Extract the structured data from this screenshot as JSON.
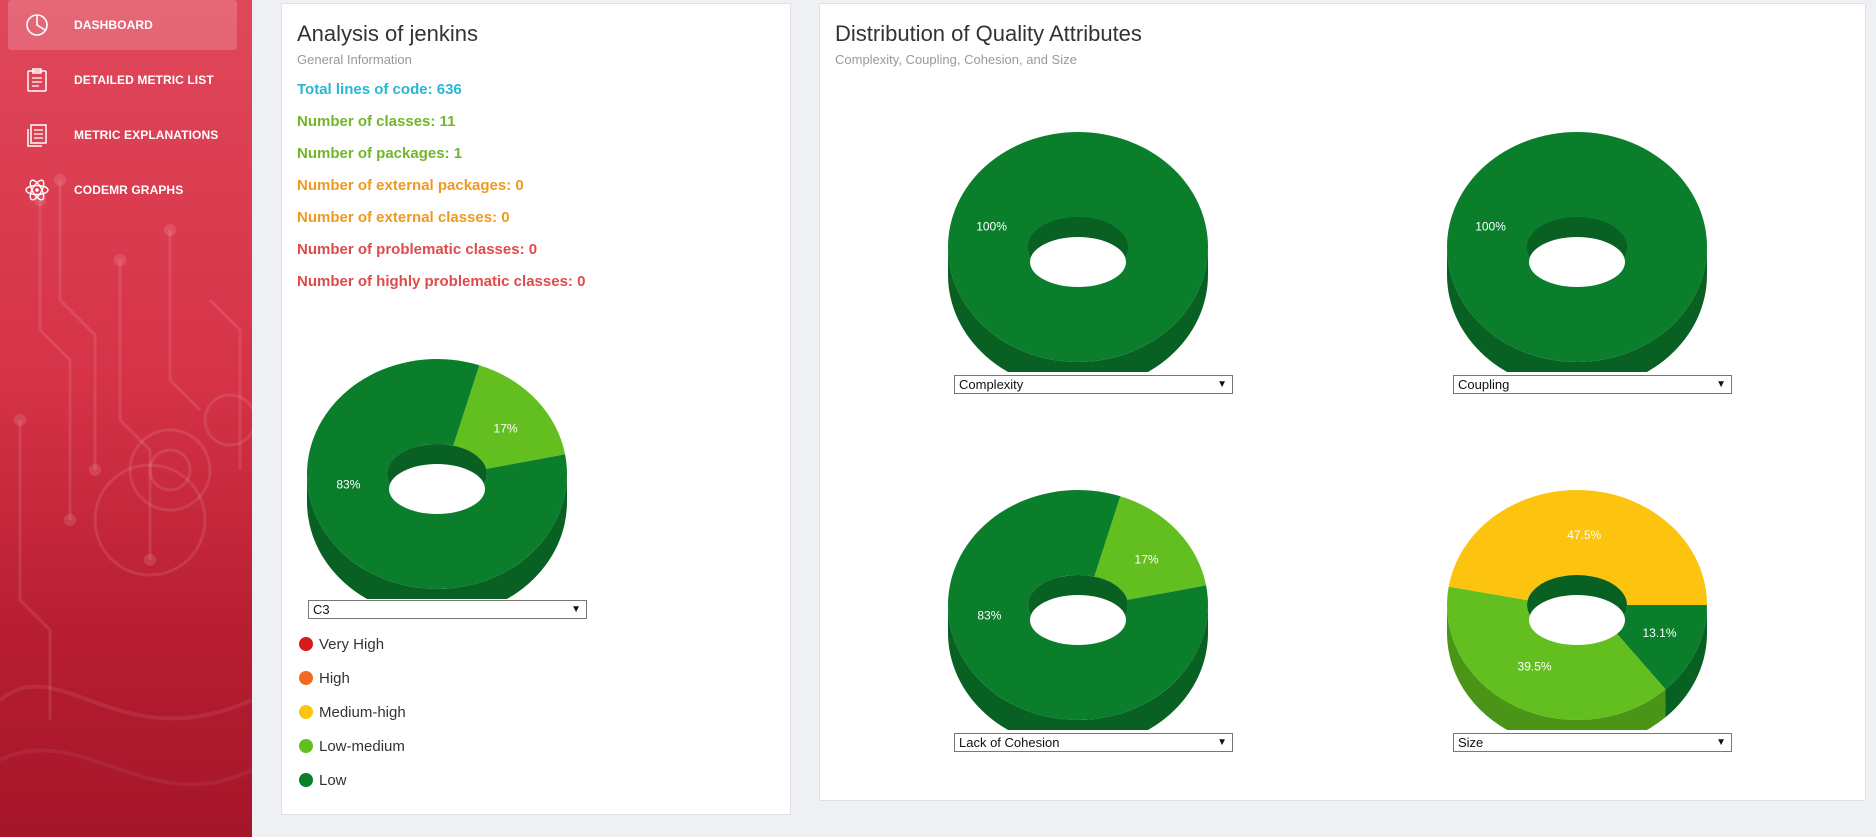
{
  "sidebar": {
    "items": [
      {
        "label": "DASHBOARD",
        "icon": "dashboard-icon",
        "active": true
      },
      {
        "label": "DETAILED METRIC LIST",
        "icon": "clipboard-list-icon",
        "active": false
      },
      {
        "label": "METRIC EXPLANATIONS",
        "icon": "document-icon",
        "active": false
      },
      {
        "label": "CODEMR GRAPHS",
        "icon": "atom-icon",
        "active": false
      }
    ]
  },
  "analysis": {
    "title": "Analysis of jenkins",
    "subtitle": "General Information",
    "stats": [
      {
        "text": "Total lines of code: 636",
        "color": "#29b6d3"
      },
      {
        "text": "Number of classes: 11",
        "color": "#72b62a"
      },
      {
        "text": "Number of packages: 1",
        "color": "#72b62a"
      },
      {
        "text": "Number of external packages: 0",
        "color": "#ef9a1e"
      },
      {
        "text": "Number of external classes: 0",
        "color": "#ef9a1e"
      },
      {
        "text": "Number of problematic classes: 0",
        "color": "#e04a4a"
      },
      {
        "text": "Number of highly problematic classes: 0",
        "color": "#e04a4a"
      }
    ],
    "c3_select": "C3",
    "legend": [
      {
        "label": "Very High",
        "color": "#d81a1a"
      },
      {
        "label": "High",
        "color": "#f26a21"
      },
      {
        "label": "Medium-high",
        "color": "#fcc40f"
      },
      {
        "label": "Low-medium",
        "color": "#62bf1f"
      },
      {
        "label": "Low",
        "color": "#0b7e2c"
      }
    ]
  },
  "distribution": {
    "title": "Distribution of Quality Attributes",
    "subtitle": "Complexity, Coupling, Cohesion, and Size",
    "selects": {
      "complexity": "Complexity",
      "coupling": "Coupling",
      "cohesion": "Lack of Cohesion",
      "size": "Size"
    }
  },
  "chart_data": [
    {
      "type": "pie",
      "name": "C3",
      "categories": [
        "Low",
        "Low-medium"
      ],
      "values": [
        83,
        17
      ],
      "labels": [
        "83%",
        "17%"
      ]
    },
    {
      "type": "pie",
      "name": "Complexity",
      "categories": [
        "Low"
      ],
      "values": [
        100
      ],
      "labels": [
        "100%"
      ]
    },
    {
      "type": "pie",
      "name": "Coupling",
      "categories": [
        "Low"
      ],
      "values": [
        100
      ],
      "labels": [
        "100%"
      ]
    },
    {
      "type": "pie",
      "name": "Lack of Cohesion",
      "categories": [
        "Low",
        "Low-medium"
      ],
      "values": [
        83,
        17
      ],
      "labels": [
        "83%",
        "17%"
      ]
    },
    {
      "type": "pie",
      "name": "Size",
      "categories": [
        "Medium-high",
        "Low-medium",
        "Low"
      ],
      "values": [
        47.5,
        39.5,
        13.1
      ],
      "labels": [
        "47.5%",
        "39.5%",
        "13.1%"
      ]
    }
  ],
  "colors": {
    "low": "#0b7e2c",
    "low_dark": "#086022",
    "low_medium": "#62bf1f",
    "low_medium_dark": "#4a9418",
    "medium_high": "#fcc40f",
    "medium_high_dark": "#c89a08"
  }
}
